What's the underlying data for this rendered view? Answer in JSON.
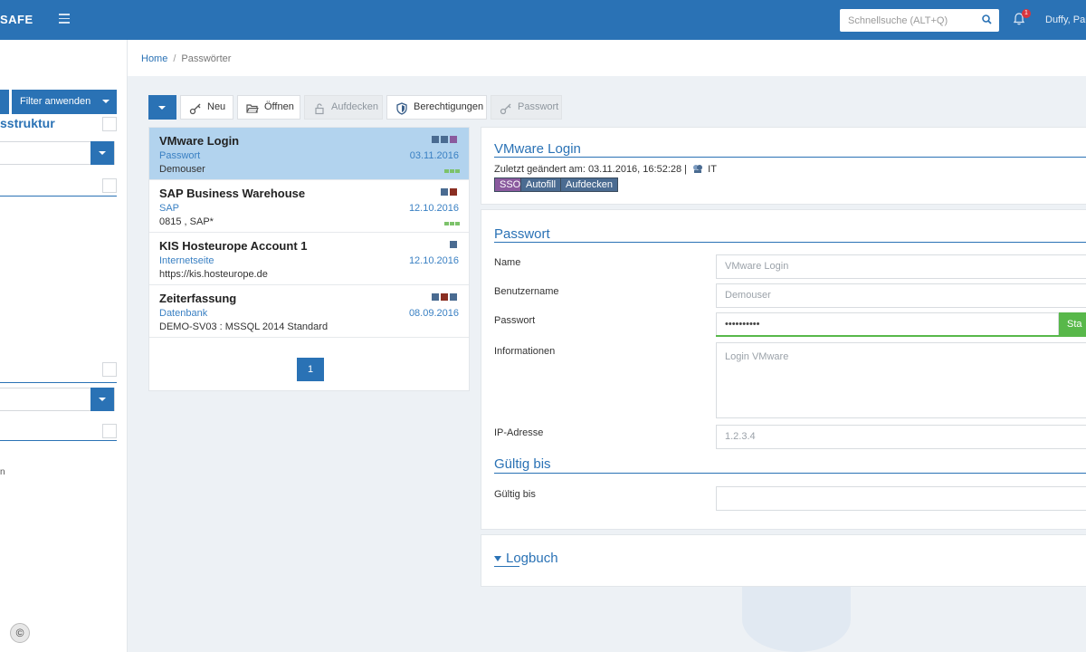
{
  "app": {
    "brand": "SAFE"
  },
  "header": {
    "search_placeholder": "Schnellsuche (ALT+Q)",
    "notification_count": "1",
    "user_name": "Duffy, Pau"
  },
  "breadcrumb": {
    "home": "Home",
    "separator": "/",
    "current": "Passwörter"
  },
  "sidebar": {
    "filter_button": "Filter anwenden",
    "section_title": "sstruktur",
    "truncated_text": "n"
  },
  "toolbar": {
    "new": "Neu",
    "open": "Öffnen",
    "reveal": "Aufdecken",
    "permissions": "Berechtigungen",
    "password": "Passwort"
  },
  "list": {
    "items": [
      {
        "title": "VMware Login",
        "category": "Passwort",
        "date": "03.11.2016",
        "subtitle": "Demouser"
      },
      {
        "title": "SAP Business Warehouse",
        "category": "SAP",
        "date": "12.10.2016",
        "subtitle": "0815 , SAP*"
      },
      {
        "title": "KIS Hosteurope Account 1",
        "category": "Internetseite",
        "date": "12.10.2016",
        "subtitle": "https://kis.hosteurope.de"
      },
      {
        "title": "Zeiterfassung",
        "category": "Datenbank",
        "date": "08.09.2016",
        "subtitle": "DEMO-SV03 : MSSQL 2014 Standard"
      }
    ],
    "page": "1"
  },
  "detail": {
    "title": "VMware Login",
    "meta": "Zuletzt geändert am: 03.11.2016, 16:52:28 |",
    "org_unit": "IT",
    "tags": [
      "SSO",
      "Autofill",
      "Aufdecken"
    ],
    "colors": {
      "sso": "#8a5a9e",
      "autofill": "#4a6b91",
      "aufdecken": "#4a6b91"
    }
  },
  "password_form": {
    "section_title": "Passwort",
    "name_label": "Name",
    "name_value": "VMware Login",
    "username_label": "Benutzername",
    "username_value": "Demouser",
    "password_label": "Passwort",
    "password_value": "••••••••••",
    "password_button": "Sta",
    "info_label": "Informationen",
    "info_value": "Login VMware",
    "ip_label": "IP-Adresse",
    "ip_value": "1.2.3.4",
    "valid_section_title": "Gültig bis",
    "valid_label": "Gültig bis"
  },
  "logbook": {
    "title": "Logbuch"
  },
  "colors": {
    "primary": "#2a72b5",
    "selected_row": "#b2d3ee",
    "strength": "#58b84a"
  }
}
